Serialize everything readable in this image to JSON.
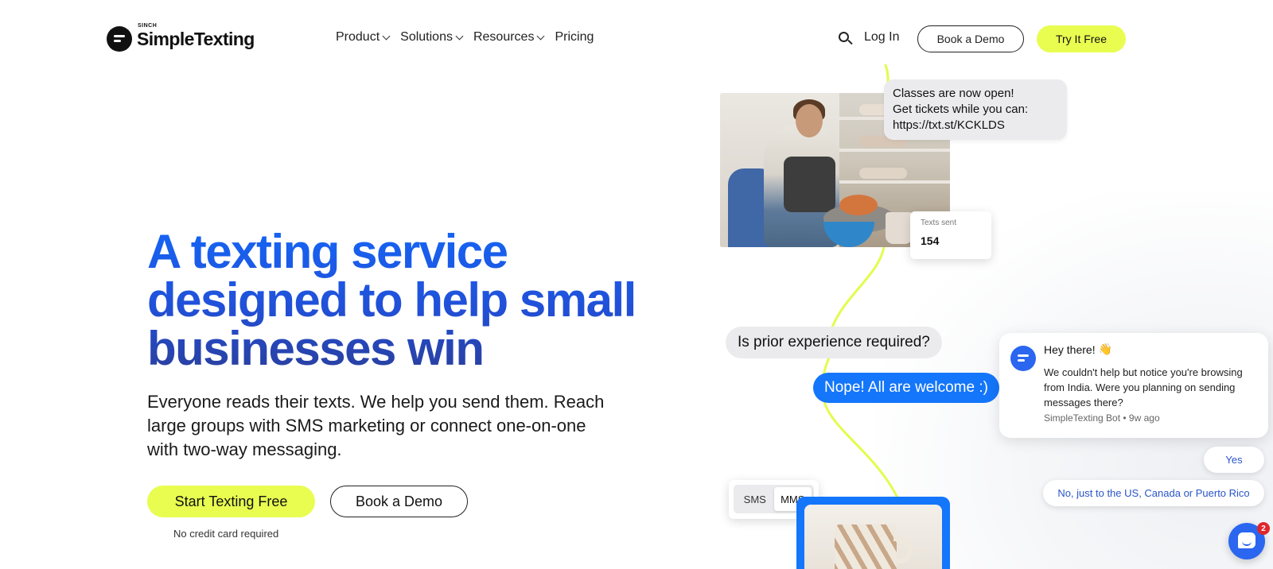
{
  "brand": {
    "sinch": "SINCH",
    "name": "SimpleTexting"
  },
  "nav": {
    "items": [
      {
        "label": "Product",
        "dropdown": true
      },
      {
        "label": "Solutions",
        "dropdown": true
      },
      {
        "label": "Resources",
        "dropdown": true
      },
      {
        "label": "Pricing",
        "dropdown": false
      }
    ],
    "search_icon": "search-icon",
    "login": "Log In",
    "book_demo": "Book a Demo",
    "try_free": "Try It Free"
  },
  "hero": {
    "title": "A texting service designed to help small businesses win",
    "subtitle": "Everyone reads their texts. We help you send them. Reach large groups with SMS marketing or connect one-on-one with two-way messaging.",
    "cta_primary": "Start Texting Free",
    "cta_secondary": "Book a Demo",
    "note": "No credit card required"
  },
  "collage": {
    "bubble_classes": [
      "Classes are now open!",
      "Get tickets while you can:",
      "https://txt.st/KCKLDS"
    ],
    "stat": {
      "label": "Texts sent",
      "value": "154"
    },
    "question": "Is prior experience required?",
    "answer": "Nope! All are welcome :)",
    "toggle": {
      "options": [
        "SMS",
        "MMS"
      ],
      "selected": "MMS"
    }
  },
  "chat": {
    "greeting": "Hey there!",
    "greeting_emoji": "👋",
    "message": "We couldn't help but notice you're browsing from India. Were you planning on sending messages there?",
    "meta": "SimpleTexting Bot • 9w ago",
    "replies": [
      "Yes",
      "No, just to the US, Canada or Puerto Rico"
    ],
    "unread": "2"
  },
  "colors": {
    "accent_lime": "#e8fd50",
    "brand_blue": "#1476fb",
    "heading_blue": "#1565f5",
    "heading_navy": "#2a3f9e",
    "badge_red": "#e0262c"
  }
}
